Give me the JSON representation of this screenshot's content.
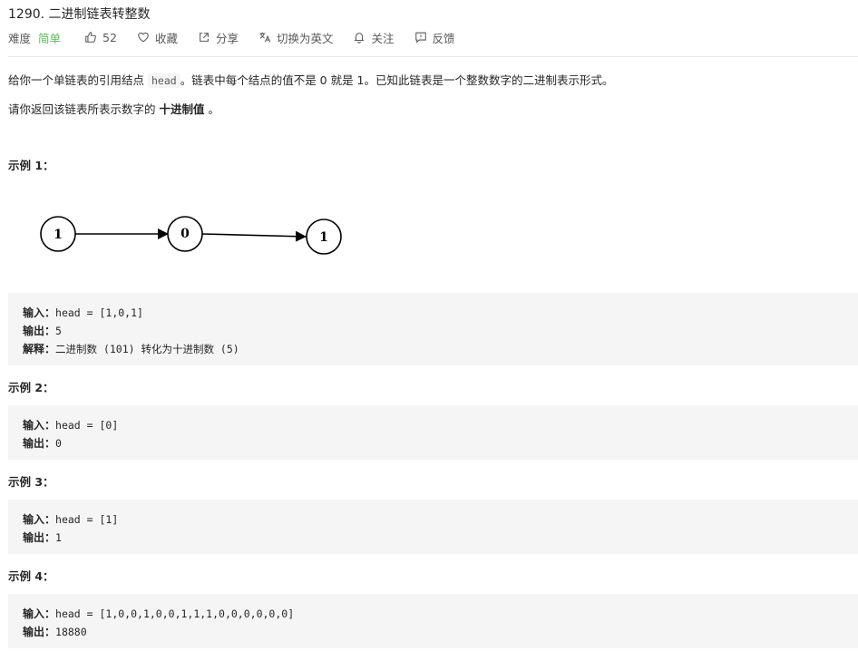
{
  "problem": {
    "title": "1290. 二进制链表转整数"
  },
  "toolbar": {
    "difficulty_label": "难度",
    "difficulty": "简单",
    "likes": "52",
    "favorite": "收藏",
    "share": "分享",
    "switch_lang": "切换为英文",
    "follow": "关注",
    "feedback": "反馈",
    "difficulty_color": "#5cb85c"
  },
  "description": {
    "p1_before": "给你一个单链表的引用结点 ",
    "p1_code": "head",
    "p1_after": "。链表中每个结点的值不是 0 就是 1。已知此链表是一个整数数字的二进制表示形式。",
    "p2_before": "请你返回该链表所表示数字的 ",
    "p2_bold": "十进制值",
    "p2_after": " 。"
  },
  "diagram": {
    "nodes": [
      "1",
      "0",
      "1"
    ]
  },
  "examples": [
    {
      "title": "示例 1：",
      "input_label": "输入：",
      "input": "head = [1,0,1]",
      "output_label": "输出：",
      "output": "5",
      "explain_label": "解释：",
      "explain": "二进制数 (101) 转化为十进制数 (5)"
    },
    {
      "title": "示例 2：",
      "input_label": "输入：",
      "input": "head = [0]",
      "output_label": "输出：",
      "output": "0"
    },
    {
      "title": "示例 3：",
      "input_label": "输入：",
      "input": "head = [1]",
      "output_label": "输出：",
      "output": "1"
    },
    {
      "title": "示例 4：",
      "input_label": "输入：",
      "input": "head = [1,0,0,1,0,0,1,1,1,0,0,0,0,0,0]",
      "output_label": "输出：",
      "output": "18880"
    }
  ]
}
